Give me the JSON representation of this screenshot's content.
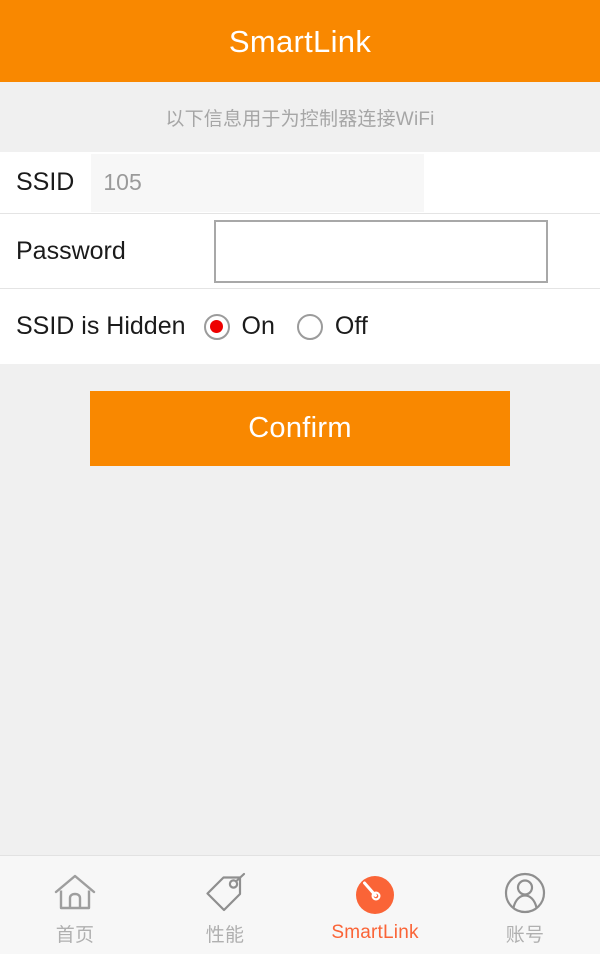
{
  "header": {
    "title": "SmartLink",
    "background_color": "#f98800",
    "text_color": "#ffffff"
  },
  "hint": {
    "text": "以下信息用于为控制器连接WiFi"
  },
  "form": {
    "ssid": {
      "label": "SSID",
      "value": "105",
      "placeholder": ""
    },
    "password": {
      "label": "Password",
      "value": "",
      "placeholder": ""
    },
    "ssid_hidden": {
      "label": "SSID is Hidden",
      "selected": "On",
      "options": [
        {
          "label": "On",
          "selected": true
        },
        {
          "label": "Off",
          "selected": false
        }
      ],
      "selected_color": "#ee0000"
    }
  },
  "actions": {
    "confirm_label": "Confirm",
    "confirm_color": "#f98800"
  },
  "bottom_nav": {
    "active_color": "#fa6437",
    "inactive_color": "#b0b0b0",
    "items": [
      {
        "label": "首页",
        "icon": "home-icon",
        "active": false
      },
      {
        "label": "性能",
        "icon": "tag-icon",
        "active": false
      },
      {
        "label": "SmartLink",
        "icon": "gauge-icon",
        "active": true
      },
      {
        "label": "账号",
        "icon": "person-icon",
        "active": false
      }
    ]
  }
}
